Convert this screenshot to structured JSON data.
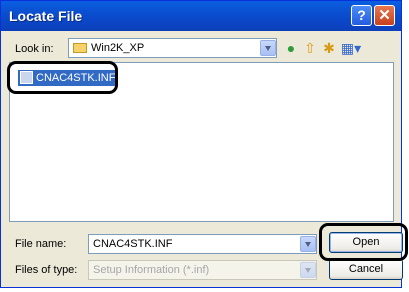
{
  "window": {
    "title": "Locate File"
  },
  "title_buttons": {
    "help": "?",
    "close": "✕"
  },
  "lookin": {
    "label": "Look in:",
    "value": "Win2K_XP"
  },
  "toolbar": {
    "icons": [
      "back-icon",
      "up-folder-icon",
      "new-folder-icon",
      "views-menu-icon"
    ]
  },
  "file_list": {
    "items": [
      {
        "name": "CNAC4STK.INF",
        "selected": true
      }
    ]
  },
  "file_name": {
    "label": "File name:",
    "value": "CNAC4STK.INF"
  },
  "file_type": {
    "label": "Files of type:",
    "value": "Setup Information (*.inf)"
  },
  "buttons": {
    "open": "Open",
    "cancel": "Cancel"
  },
  "colors": {
    "titlebar": "#0a5fe0",
    "selection": "#316ac5",
    "highlight_ring": "#000000"
  }
}
